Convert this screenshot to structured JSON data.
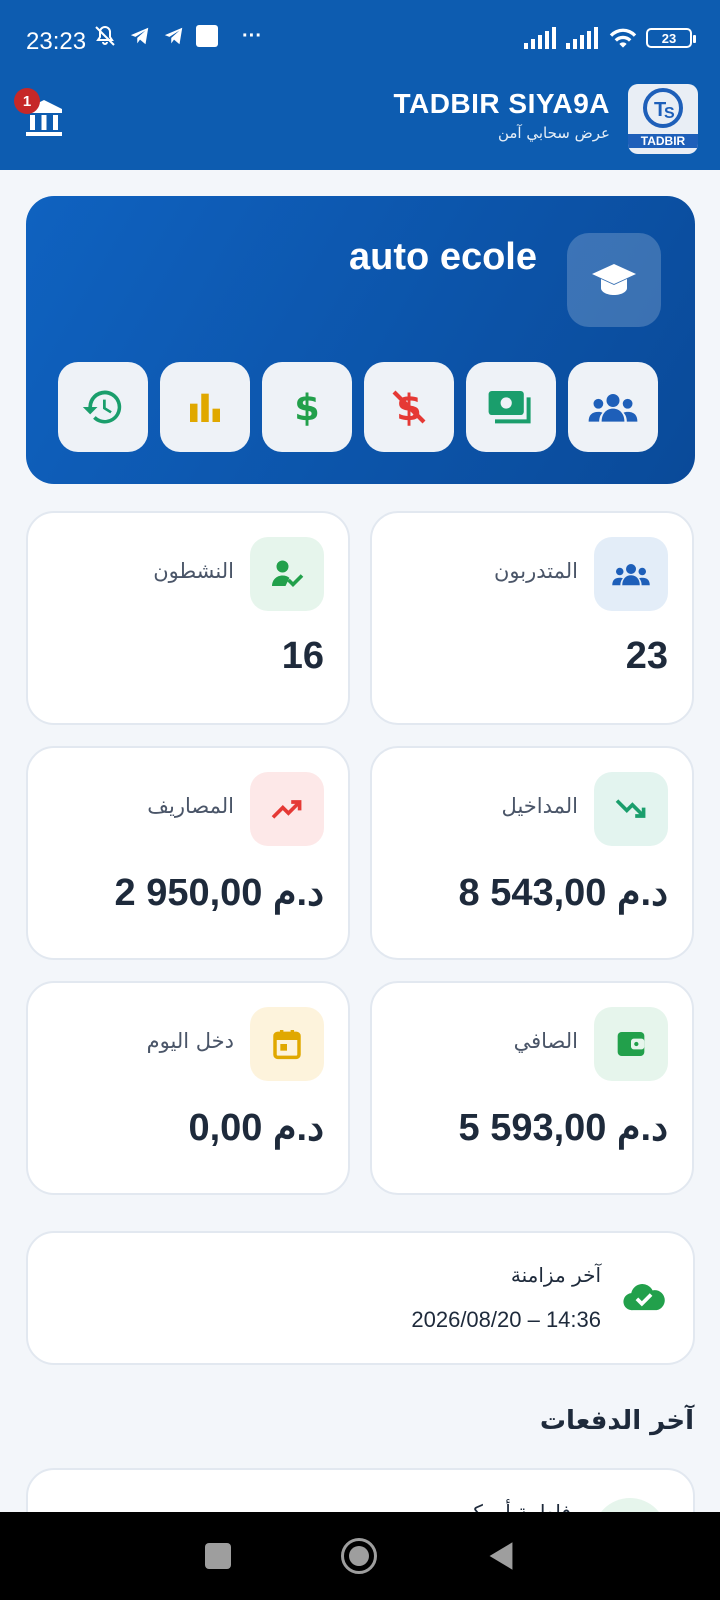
{
  "status_bar": {
    "time": "23:23",
    "dots": "···",
    "battery": "23"
  },
  "app_bar": {
    "notification_count": "1",
    "brand_title": "TADBIR SIYA9A",
    "brand_subtitle": "عرض سحابي آمن",
    "logo_text": "TADBIR"
  },
  "hero": {
    "title": "auto ecole",
    "icon": "graduation-cap-icon",
    "actions": [
      {
        "name": "history-button",
        "icon": "history-icon",
        "color": "#1a9e6c"
      },
      {
        "name": "stats-button",
        "icon": "bar-chart-icon",
        "color": "#e0a800"
      },
      {
        "name": "income-button",
        "icon": "dollar-icon",
        "color": "#22a04b"
      },
      {
        "name": "expense-button",
        "icon": "no-dollar-icon",
        "color": "#e53935"
      },
      {
        "name": "payments-button",
        "icon": "money-bill-icon",
        "color": "#1a9e6c"
      },
      {
        "name": "trainees-button",
        "icon": "users-icon",
        "color": "#1e5fb9"
      }
    ]
  },
  "stats": {
    "trainees": {
      "label": "المتدربون",
      "value": "23"
    },
    "active": {
      "label": "النشطون",
      "value": "16"
    },
    "income": {
      "label": "المداخيل",
      "value": "8 543,00 د.م"
    },
    "expenses": {
      "label": "المصاريف",
      "value": "2 950,00 د.م"
    },
    "net": {
      "label": "الصافي",
      "value": "5 593,00 د.م"
    },
    "today": {
      "label": "دخل اليوم",
      "value": "0,00 د.م"
    }
  },
  "sync": {
    "title": "آخر مزامنة",
    "datetime": "2026/08/20 – 14:36"
  },
  "recent_payments": {
    "title": "آخر الدفعات",
    "first_item_partial": "فاطمة أو..كر"
  },
  "colors": {
    "primary": "#0d5cb0",
    "background": "#f3f6fa",
    "success": "#22a04b",
    "danger": "#e53935",
    "warning": "#e0a800"
  }
}
